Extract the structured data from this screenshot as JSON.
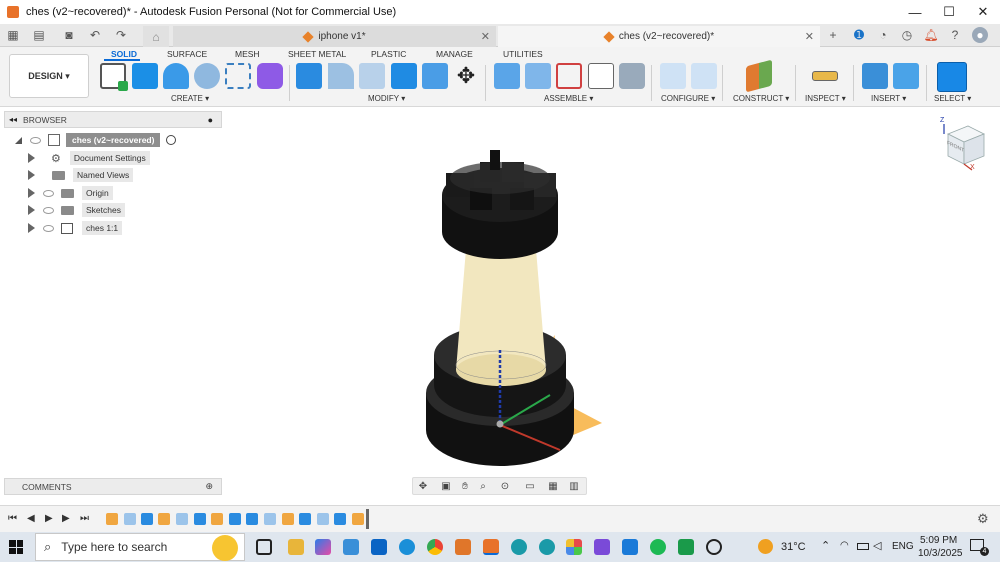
{
  "window": {
    "title": "ches (v2~recovered)* - Autodesk Fusion Personal (Not for Commercial Use)",
    "minimize": "—",
    "maximize": "☐",
    "close": "✕"
  },
  "tabs": [
    {
      "label": "iphone v1*",
      "active": false
    },
    {
      "label": "ches (v2~recovered)*",
      "active": true
    }
  ],
  "toolbar": {
    "workspace": "DESIGN ▾",
    "workspace_tabs": [
      "SOLID",
      "SURFACE",
      "MESH",
      "SHEET METAL",
      "PLASTIC",
      "MANAGE",
      "UTILITIES"
    ],
    "groups": [
      "CREATE ▾",
      "MODIFY ▾",
      "ASSEMBLE ▾",
      "CONFIGURE ▾",
      "CONSTRUCT ▾",
      "INSPECT ▾",
      "INSERT ▾",
      "SELECT ▾"
    ]
  },
  "browser": {
    "title": "BROWSER",
    "root": "ches (v2~recovered)",
    "items": [
      {
        "label": "Document Settings",
        "icon": "gear-icon"
      },
      {
        "label": "Named Views",
        "icon": "folder-icon"
      },
      {
        "label": "Origin",
        "icon": "folder-icon"
      },
      {
        "label": "Sketches",
        "icon": "folder-icon"
      },
      {
        "label": "ches 1:1",
        "icon": "component-icon"
      }
    ]
  },
  "comments": {
    "title": "COMMENTS"
  },
  "viewcube": {
    "face": "FRONT",
    "axes": [
      "Z",
      "X"
    ]
  },
  "taskbar": {
    "search_placeholder": "Type here to search",
    "weather": "31°C",
    "language": "ENG",
    "time": "5:09 PM",
    "date": "10/3/2025",
    "notification_count": "4"
  },
  "colors": {
    "accent": "#0a6ad6",
    "rook_black": "#1a1a1a",
    "rook_body": "#f2e7bf",
    "plane": "#f5b041",
    "fusion_orange": "#e8722a"
  }
}
